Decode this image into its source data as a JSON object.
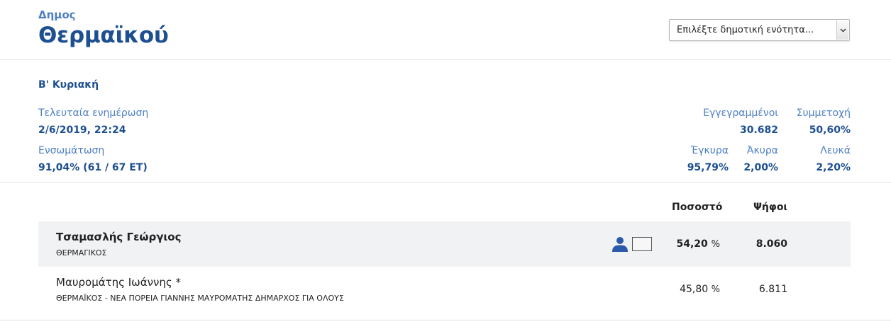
{
  "header": {
    "municipality_label": "Δημος",
    "municipality_name": "Θερμαϊκού",
    "unit_select": {
      "selected": "Επιλέξτε δημοτική ενότητα...",
      "arrow_icon": "chevron-down-icon"
    }
  },
  "stats": {
    "round": "Β' Κυριακή",
    "last_update": {
      "label": "Τελευταία ενημέρωση",
      "value": "2/6/2019, 22:24"
    },
    "integration": {
      "label": "Ενσωμάτωση",
      "value": "91,04% (61 / 67 ΕΤ)"
    },
    "registered": {
      "label": "Εγγεγραμμένοι",
      "value": "30.682"
    },
    "turnout": {
      "label": "Συμμετοχή",
      "value": "50,60%"
    },
    "valid": {
      "label": "Έγκυρα",
      "value": "95,79%"
    },
    "invalid": {
      "label": "Άκυρα",
      "value": "2,00%"
    },
    "blank": {
      "label": "Λευκά",
      "value": "2,20%"
    }
  },
  "results": {
    "columns": {
      "percentage": "Ποσοστό",
      "votes": "Ψήφοι"
    },
    "pct_unit": "%",
    "candidates": [
      {
        "name": "Τσαμασλής Γεώργιος",
        "party": "ΘΕΡΜΑΓΙΚΟΣ",
        "percentage": "54,20",
        "votes": "8.060",
        "elected": true,
        "icon": "person-icon"
      },
      {
        "name": "Μαυρομάτης Ιωάννης *",
        "party": "ΘΕΡΜΑΪΚΟΣ - ΝΕΑ ΠΟΡΕΙΑ ΓΙΑΝΝΗΣ ΜΑΥΡΟΜΑΤΗΣ ΔΗΜΑΡΧΟΣ ΓΙΑ ΟΛΟΥΣ",
        "percentage": "45,80",
        "votes": "6.811",
        "elected": false
      }
    ]
  },
  "colors": {
    "primary": "#1d4f91",
    "label": "#4d7fc4",
    "winner_row_bg": "#f1f2f4",
    "icon": "#2a5aa8"
  }
}
